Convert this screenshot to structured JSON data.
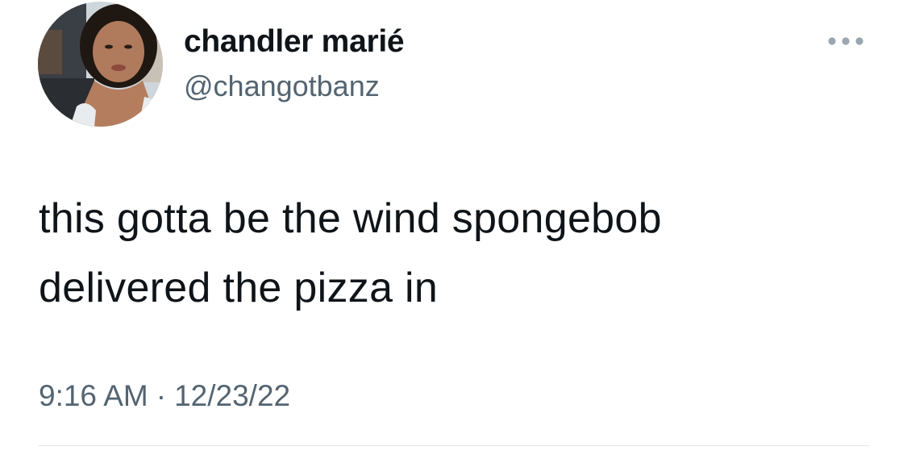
{
  "author": {
    "display_name": "chandler marié",
    "handle": "@changotbanz"
  },
  "tweet": {
    "text_lines": [
      "this gotta be the wind spongebob",
      "delivered the pizza in"
    ],
    "time": "9:16 AM",
    "separator": "·",
    "date": "12/23/22"
  },
  "icons": {
    "avatar": "profile-photo",
    "more": "more-horizontal-icon"
  },
  "colors": {
    "primary_text": "#0f1419",
    "secondary_text": "#536471",
    "divider": "#e1e6ea",
    "icon": "#9aa6b0"
  }
}
